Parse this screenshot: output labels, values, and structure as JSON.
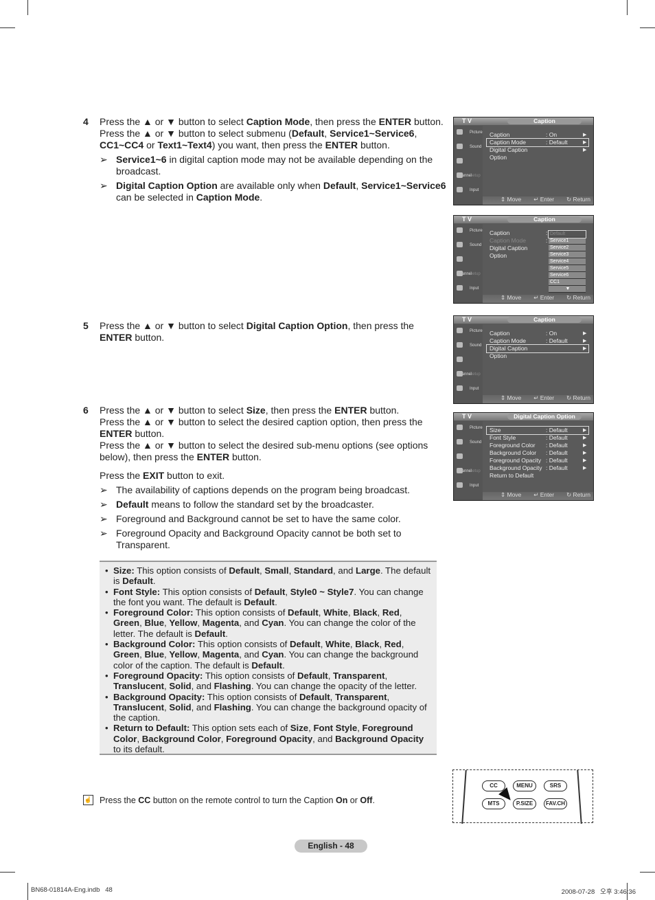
{
  "steps": [
    {
      "number": "4",
      "lines": [
        [
          "Press the ▲ or ▼ button to select ",
          {
            "b": "Caption Mode"
          },
          ", then press the ",
          {
            "b": "ENTER"
          },
          " button."
        ],
        [
          "Press the ▲ or ▼ button to select submenu (",
          {
            "b": "Default"
          },
          ", ",
          {
            "b": "Service1~Service6"
          },
          ", ",
          {
            "b": "CC1~CC4"
          },
          " or ",
          {
            "b": "Text1~Text4"
          },
          ") you want, then press the ",
          {
            "b": "ENTER"
          },
          " button."
        ]
      ],
      "notes": [
        [
          {
            "b": "Service1~6"
          },
          " in digital caption mode may not be available depending on the broadcast."
        ],
        [
          {
            "b": "Digital Caption Option"
          },
          " are available only when ",
          {
            "b": "Default"
          },
          ", ",
          {
            "b": "Service1~Service6"
          },
          " can be selected in ",
          {
            "b": "Caption Mode"
          },
          "."
        ]
      ]
    },
    {
      "number": "5",
      "lines": [
        [
          "Press the ▲ or ▼ button to select ",
          {
            "b": "Digital Caption Option"
          },
          ", then press the ",
          {
            "b": "ENTER"
          },
          " button."
        ]
      ],
      "notes": []
    },
    {
      "number": "6",
      "lines": [
        [
          "Press the ▲ or ▼ button to select ",
          {
            "b": "Size"
          },
          ", then press the ",
          {
            "b": "ENTER"
          },
          " button."
        ],
        [
          "Press the ▲ or ▼ button to select the desired caption option, then press the ",
          {
            "b": "ENTER"
          },
          " button."
        ],
        [
          "Press the ▲ or ▼ button to select the desired sub-menu options (see options below), then press the ",
          {
            "b": "ENTER"
          },
          " button."
        ],
        [
          "GAP"
        ],
        [
          "Press the ",
          {
            "b": "EXIT"
          },
          " button to exit."
        ]
      ],
      "notes": [
        [
          "The availability of captions depends on the program being broadcast."
        ],
        [
          {
            "b": "Default"
          },
          " means to follow the standard set by the broadcaster."
        ],
        [
          "Foreground and Background cannot be set to have the same color."
        ],
        [
          "Foreground Opacity and Background Opacity cannot be both set to Transparent."
        ]
      ]
    }
  ],
  "note_arrow": "➢",
  "options": [
    [
      {
        "b": "Size:"
      },
      " This option consists of ",
      {
        "b": "Default"
      },
      ", ",
      {
        "b": "Small"
      },
      ", ",
      {
        "b": "Standard"
      },
      ", and ",
      {
        "b": "Large"
      },
      ". The default is ",
      {
        "b": "Default"
      },
      "."
    ],
    [
      {
        "b": "Font Style:"
      },
      " This option consists of ",
      {
        "b": "Default"
      },
      ", ",
      {
        "b": "Style0 ~ Style7"
      },
      ". You can change the font you want. The default is ",
      {
        "b": "Default"
      },
      "."
    ],
    [
      {
        "b": "Foreground Color:"
      },
      " This option consists of ",
      {
        "b": "Default"
      },
      ", ",
      {
        "b": "White"
      },
      ", ",
      {
        "b": "Black"
      },
      ", ",
      {
        "b": "Red"
      },
      ", ",
      {
        "b": "Green"
      },
      ", ",
      {
        "b": "Blue"
      },
      ", ",
      {
        "b": "Yellow"
      },
      ", ",
      {
        "b": "Magenta"
      },
      ", and ",
      {
        "b": "Cyan"
      },
      ". You can change the color of the letter. The default is ",
      {
        "b": "Default"
      },
      "."
    ],
    [
      {
        "b": "Background Color:"
      },
      " This option consists of ",
      {
        "b": "Default"
      },
      ", ",
      {
        "b": "White"
      },
      ", ",
      {
        "b": "Black"
      },
      ", ",
      {
        "b": "Red"
      },
      ", ",
      {
        "b": "Green"
      },
      ", ",
      {
        "b": "Blue"
      },
      ", ",
      {
        "b": "Yellow"
      },
      ", ",
      {
        "b": "Magenta"
      },
      ", and ",
      {
        "b": "Cyan"
      },
      ". You can change the background color of the caption. The default is ",
      {
        "b": "Default"
      },
      "."
    ],
    [
      {
        "b": "Foreground Opacity:"
      },
      " This option consists of ",
      {
        "b": "Default"
      },
      ", ",
      {
        "b": "Transparent"
      },
      ", ",
      {
        "b": "Translucent"
      },
      ", ",
      {
        "b": "Solid"
      },
      ", and ",
      {
        "b": "Flashing"
      },
      ". You can change the opacity of the letter."
    ],
    [
      {
        "b": "Background Opacity:"
      },
      " This option consists of ",
      {
        "b": "Default"
      },
      ", ",
      {
        "b": "Transparent"
      },
      ", ",
      {
        "b": "Translucent"
      },
      ", ",
      {
        "b": "Solid"
      },
      ", and ",
      {
        "b": "Flashing"
      },
      ". You can change the background opacity of the caption."
    ],
    [
      {
        "b": "Return to Default:"
      },
      " This option sets each of ",
      {
        "b": "Size"
      },
      ", ",
      {
        "b": "Font Style"
      },
      ", ",
      {
        "b": "Foreground Color"
      },
      ", ",
      {
        "b": "Background Color"
      },
      ", ",
      {
        "b": "Foreground Opacity"
      },
      ", and ",
      {
        "b": "Background Opacity"
      },
      " to its default."
    ]
  ],
  "osd_common": {
    "tv_label": "T V",
    "sidebar": [
      "Picture",
      "Sound",
      "Channel",
      "Setup",
      "Input"
    ],
    "footer": {
      "move": "⇕ Move",
      "enter": "↵ Enter",
      "return": "↻ Return"
    },
    "arrow": "▶"
  },
  "screens": [
    {
      "title": "Caption",
      "rows": [
        {
          "label": "Caption",
          "value": ": On",
          "arrow": true
        },
        {
          "label": "Caption Mode",
          "value": ": Default",
          "arrow": true,
          "selected": true
        },
        {
          "label": "Digital Caption Option",
          "value": "",
          "arrow": true
        }
      ]
    },
    {
      "title": "Caption",
      "rows": [
        {
          "label": "Caption",
          "value": ":",
          "arrow": false
        },
        {
          "label": "Caption Mode",
          "value": ":",
          "arrow": false,
          "dim": true
        },
        {
          "label": "Digital Caption Option",
          "value": "",
          "arrow": false
        }
      ],
      "dropdown": [
        "Default",
        "Service1",
        "Service2",
        "Service3",
        "Service4",
        "Service5",
        "Service6",
        "CC1",
        "▼"
      ]
    },
    {
      "title": "Caption",
      "rows": [
        {
          "label": "Caption",
          "value": ": On",
          "arrow": true
        },
        {
          "label": "Caption Mode",
          "value": ": Default",
          "arrow": true
        },
        {
          "label": "Digital Caption Option",
          "value": "",
          "arrow": true,
          "selected": true
        }
      ]
    },
    {
      "title": "Digital Caption Option",
      "rows": [
        {
          "label": "Size",
          "value": ": Default",
          "arrow": true,
          "selected": true
        },
        {
          "label": "Font Style",
          "value": ": Default",
          "arrow": true
        },
        {
          "label": "Foreground Color",
          "value": ": Default",
          "arrow": true
        },
        {
          "label": "Background Color",
          "value": ": Default",
          "arrow": true
        },
        {
          "label": "Foreground Opacity",
          "value": ": Default",
          "arrow": true
        },
        {
          "label": "Background Opacity",
          "value": ": Default",
          "arrow": true
        },
        {
          "label": "Return to Default",
          "value": "",
          "arrow": false
        }
      ]
    }
  ],
  "remote": {
    "buttons": [
      "CC",
      "MENU",
      "SRS",
      "MTS",
      "P.SIZE",
      "FAV.CH"
    ]
  },
  "tip": [
    "Press the ",
    {
      "b": "CC"
    },
    " button on the remote control to turn the Caption ",
    {
      "b": "On"
    },
    " or ",
    {
      "b": "Off"
    },
    "."
  ],
  "page_label": "English - 48",
  "footer": {
    "left": "BN68-01814A-Eng.indb   48",
    "right": "2008-07-28   오후 3:46:36"
  }
}
